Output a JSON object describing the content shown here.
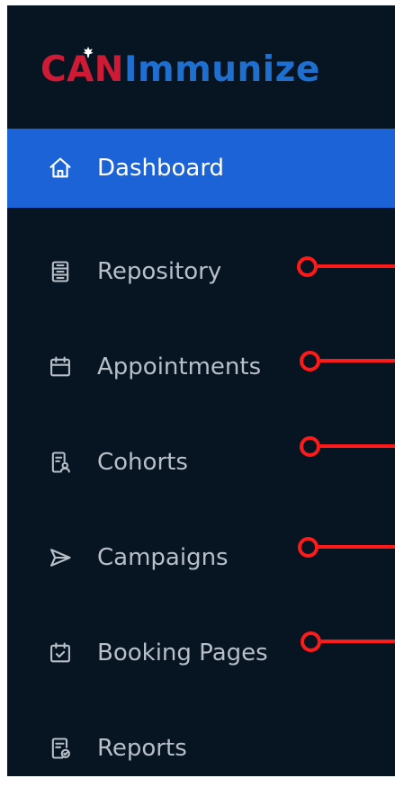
{
  "brand": {
    "part1": "CAN",
    "part2": "Immunize",
    "colors": {
      "red": "#cf1a35",
      "blue": "#1f6fd0"
    }
  },
  "sidebar": {
    "background": "#071421",
    "active_color": "#1d63d8",
    "items": [
      {
        "label": "Dashboard",
        "icon": "home-icon",
        "active": true
      },
      {
        "label": "Repository",
        "icon": "repository-icon",
        "active": false
      },
      {
        "label": "Appointments",
        "icon": "calendar-icon",
        "active": false
      },
      {
        "label": "Cohorts",
        "icon": "cohorts-icon",
        "active": false
      },
      {
        "label": "Campaigns",
        "icon": "send-icon",
        "active": false
      },
      {
        "label": "Booking Pages",
        "icon": "calendar-check-icon",
        "active": false
      },
      {
        "label": "Reports",
        "icon": "report-icon",
        "active": false
      }
    ]
  },
  "annotations": {
    "color": "#ff1a1a",
    "marked_items": [
      "Repository",
      "Appointments",
      "Cohorts",
      "Campaigns",
      "Booking Pages"
    ]
  }
}
